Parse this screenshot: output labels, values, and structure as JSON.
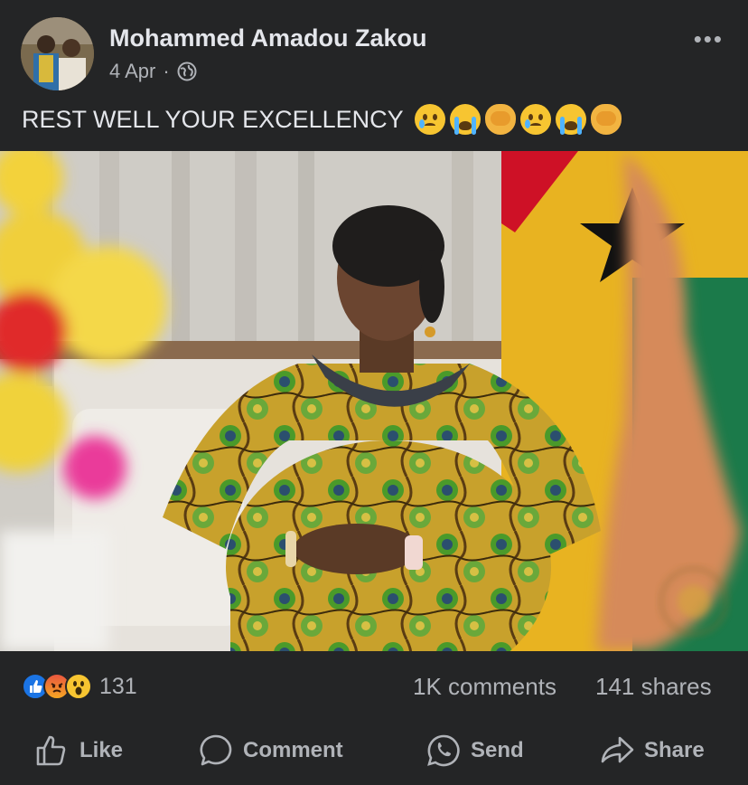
{
  "post": {
    "author": "Mohammed Amadou Zakou",
    "date": "4 Apr",
    "separator": "·",
    "audience_icon": "globe-icon",
    "more_label": "•••",
    "caption": "REST WELL YOUR EXCELLENCY",
    "caption_emojis": [
      "crying-face",
      "loudly-crying-face",
      "woman-facepalming",
      "crying-face",
      "loudly-crying-face",
      "woman-facepalming"
    ]
  },
  "stats": {
    "reaction_icons": [
      "like-icon",
      "angry-icon",
      "wow-icon"
    ],
    "reaction_count": "131",
    "comments": "1K comments",
    "shares": "141 shares"
  },
  "actions": {
    "like": "Like",
    "comment": "Comment",
    "send": "Send",
    "share": "Share"
  },
  "colors": {
    "background": "#242526",
    "primary_text": "#e4e6eb",
    "secondary_text": "#b0b3b8",
    "like_blue": "#1b74e4"
  }
}
